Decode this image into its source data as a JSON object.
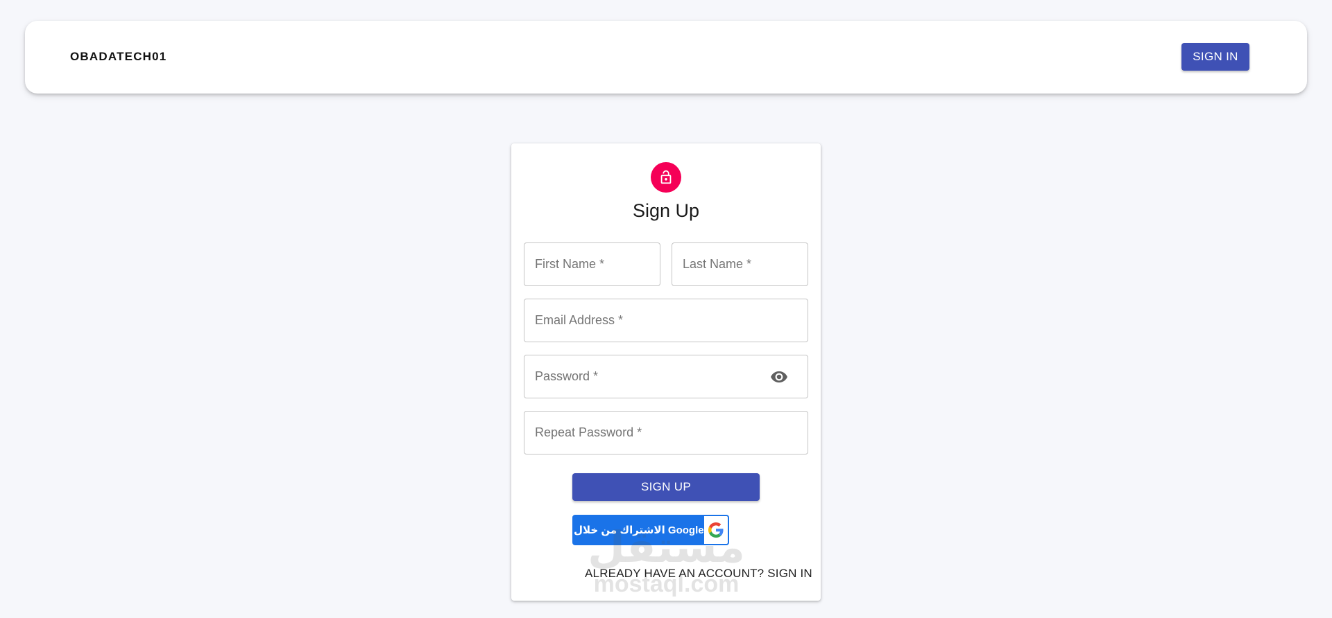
{
  "appbar": {
    "brand": "OBADATECH01",
    "signin_label": "SIGN IN"
  },
  "card": {
    "icon": "lock-icon",
    "title": "Sign Up",
    "fields": {
      "first_name_placeholder": "First Name *",
      "last_name_placeholder": "Last Name *",
      "email_placeholder": "Email Address *",
      "password_placeholder": "Password *",
      "repeat_password_placeholder": "Repeat Password *"
    },
    "signup_label": "SIGN UP",
    "google_label": "الاشتراك من خلال Google",
    "have_account_label": "ALREADY HAVE AN ACCOUNT? SIGN IN"
  },
  "watermark": {
    "arabic": "مستقل",
    "latin": "mostaql.com"
  },
  "colors": {
    "primary": "#3f51b5",
    "avatar": "#f50057",
    "google_blue": "#1a73e8",
    "background": "#f6f7fb"
  }
}
